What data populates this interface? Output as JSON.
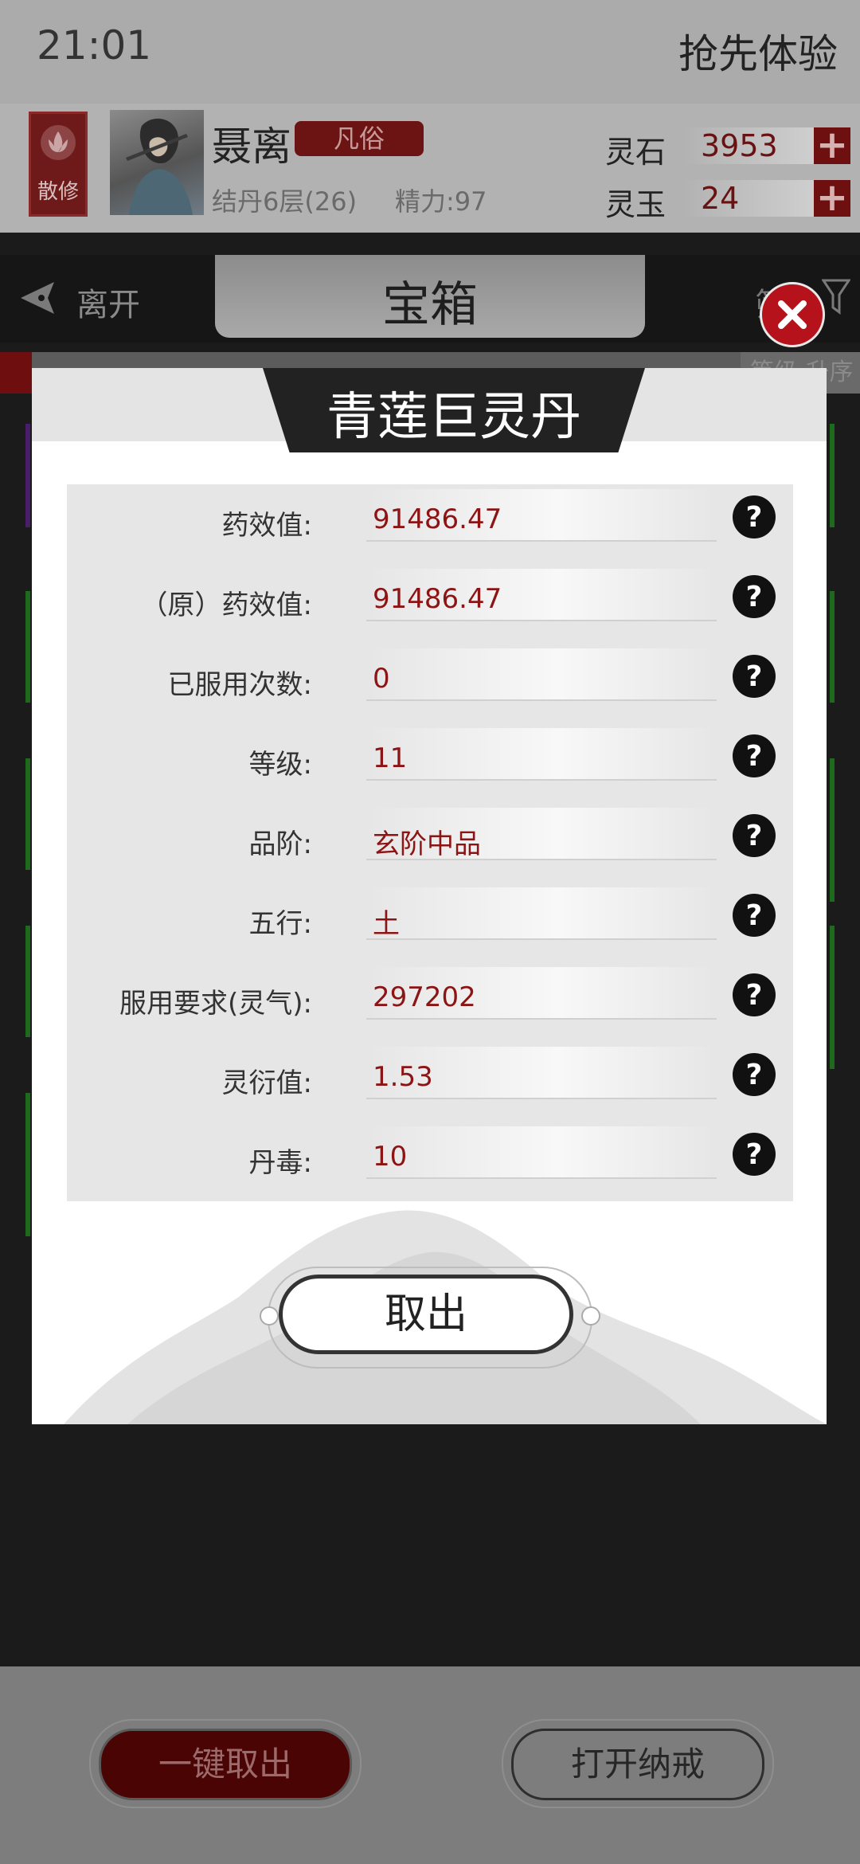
{
  "status": {
    "time": "21:01",
    "promo": "抢先体验"
  },
  "player": {
    "sect_label": "散修",
    "name": "聂离",
    "rank": "凡俗",
    "realm": "结丹6层(26)",
    "energy": "精力:97",
    "currencies": [
      {
        "label": "灵石",
        "value": "3953"
      },
      {
        "label": "灵玉",
        "value": "24"
      }
    ]
  },
  "nav": {
    "leave_label": "离开",
    "title": "宝箱",
    "filter_label": "筛"
  },
  "list": {
    "sort_label": "等级 升序"
  },
  "modal": {
    "title": "青莲巨灵丹",
    "attributes": [
      {
        "label": "药效值:",
        "value": "91486.47"
      },
      {
        "label": "（原）药效值:",
        "value": "91486.47"
      },
      {
        "label": "已服用次数:",
        "value": "0"
      },
      {
        "label": "等级:",
        "value": "11"
      },
      {
        "label": "品阶:",
        "value": "玄阶中品"
      },
      {
        "label": "五行:",
        "value": "土"
      },
      {
        "label": "服用要求(灵气):",
        "value": "297202"
      },
      {
        "label": "灵衍值:",
        "value": "1.53"
      },
      {
        "label": "丹毒:",
        "value": "10"
      }
    ],
    "take_out_label": "取出"
  },
  "bottom": {
    "take_all_label": "一键取出",
    "open_ring_label": "打开纳戒"
  },
  "colors": {
    "accent_red": "#8c1414",
    "close_red": "#b5121b",
    "dim_red": "#4b0404"
  }
}
